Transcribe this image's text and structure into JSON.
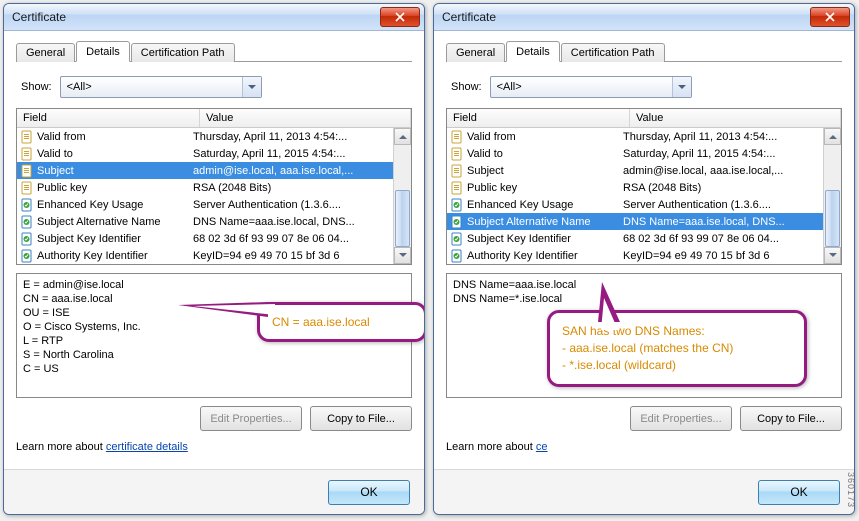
{
  "common": {
    "title": "Certificate",
    "tabs": {
      "general": "General",
      "details": "Details",
      "certpath": "Certification Path"
    },
    "show_label": "Show:",
    "show_value": "<All>",
    "col_field": "Field",
    "col_value": "Value",
    "edit_btn": "Edit Properties...",
    "copy_btn": "Copy to File...",
    "learn_prefix": "Learn more about ",
    "learn_link": "certificate details",
    "learn_link_short": "ce",
    "ok": "OK"
  },
  "left": {
    "rows": [
      {
        "f": "Valid from",
        "v": "Thursday, April 11, 2013 4:54:...",
        "ic": "doc"
      },
      {
        "f": "Valid to",
        "v": "Saturday, April 11, 2015 4:54:...",
        "ic": "doc"
      },
      {
        "f": "Subject",
        "v": "admin@ise.local, aaa.ise.local,...",
        "ic": "doc",
        "sel": true
      },
      {
        "f": "Public key",
        "v": "RSA (2048 Bits)",
        "ic": "doc"
      },
      {
        "f": "Enhanced Key Usage",
        "v": "Server Authentication (1.3.6....",
        "ic": "ext"
      },
      {
        "f": "Subject Alternative Name",
        "v": "DNS Name=aaa.ise.local, DNS...",
        "ic": "ext"
      },
      {
        "f": "Subject Key Identifier",
        "v": "68 02 3d 6f 93 99 07 8e 06 04...",
        "ic": "ext"
      },
      {
        "f": "Authority Key Identifier",
        "v": "KeyID=94 e9 49 70 15 bf 3d 6",
        "ic": "ext"
      }
    ],
    "detail": "E = admin@ise.local\nCN = aaa.ise.local\nOU = ISE\nO = Cisco Systems, Inc.\nL = RTP\nS = North Carolina\nC = US",
    "callout": "CN = aaa.ise.local"
  },
  "right": {
    "rows": [
      {
        "f": "Valid from",
        "v": "Thursday, April 11, 2013 4:54:...",
        "ic": "doc"
      },
      {
        "f": "Valid to",
        "v": "Saturday, April 11, 2015 4:54:...",
        "ic": "doc"
      },
      {
        "f": "Subject",
        "v": "admin@ise.local, aaa.ise.local,...",
        "ic": "doc"
      },
      {
        "f": "Public key",
        "v": "RSA (2048 Bits)",
        "ic": "doc"
      },
      {
        "f": "Enhanced Key Usage",
        "v": "Server Authentication (1.3.6....",
        "ic": "ext"
      },
      {
        "f": "Subject Alternative Name",
        "v": "DNS Name=aaa.ise.local, DNS...",
        "ic": "ext",
        "sel": true
      },
      {
        "f": "Subject Key Identifier",
        "v": "68 02 3d 6f 93 99 07 8e 06 04...",
        "ic": "ext"
      },
      {
        "f": "Authority Key Identifier",
        "v": "KeyID=94 e9 49 70 15 bf 3d 6",
        "ic": "ext"
      }
    ],
    "detail": "DNS Name=aaa.ise.local\nDNS Name=*.ise.local",
    "callout": "SAN has two DNS Names:\n- aaa.ise.local (matches the CN)\n- *.ise.local (wildcard)"
  },
  "image_id": "360173"
}
